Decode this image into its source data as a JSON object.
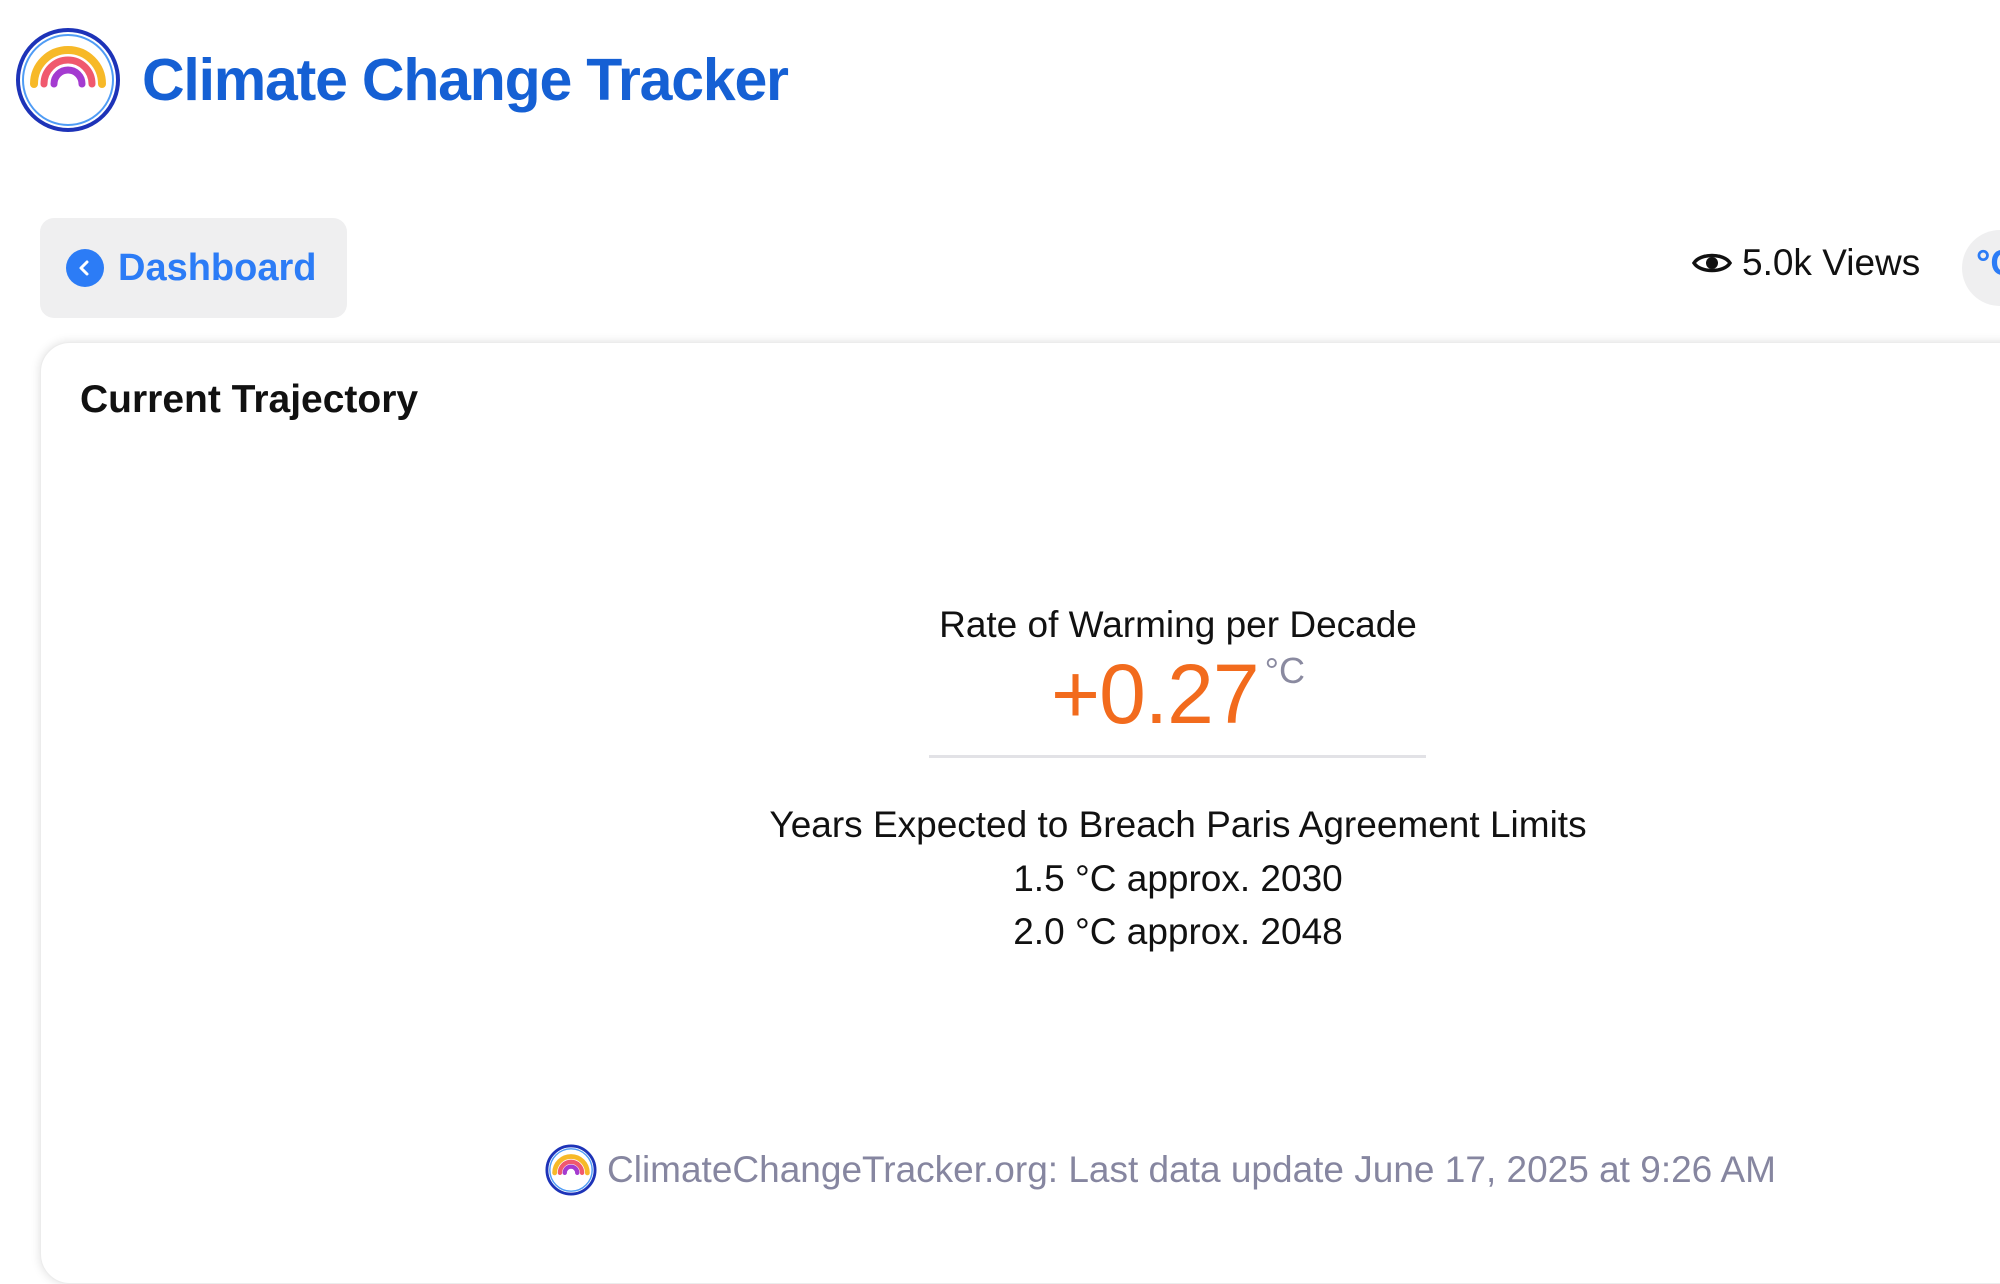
{
  "header": {
    "logo_icon": "rainbow-logo-icon",
    "title": "Climate Change Tracker"
  },
  "toolbar": {
    "back_icon": "chevron-left-icon",
    "back_label": "Dashboard",
    "views_icon": "eye-icon",
    "views_label": "5.0k Views",
    "unit_toggle_label": "°C"
  },
  "card": {
    "title": "Current Trajectory",
    "rate_label": "Rate of Warming per Decade",
    "rate_value": "+0.27",
    "rate_unit": "°C",
    "breach_heading": "Years Expected to Breach Paris Agreement Limits",
    "breach_rows": [
      {
        "text": "1.5 °C approx. 2030"
      },
      {
        "text": "2.0 °C approx. 2048"
      }
    ],
    "footer_icon": "rainbow-logo-icon",
    "footer_text": "ClimateChangeTracker.org: Last data update June 17, 2025 at 9:26 AM"
  },
  "colors": {
    "brand_blue": "#1560d4",
    "link_blue": "#2c7cf6",
    "accent_orange": "#f26b1d",
    "muted_gray": "#8686a0"
  }
}
